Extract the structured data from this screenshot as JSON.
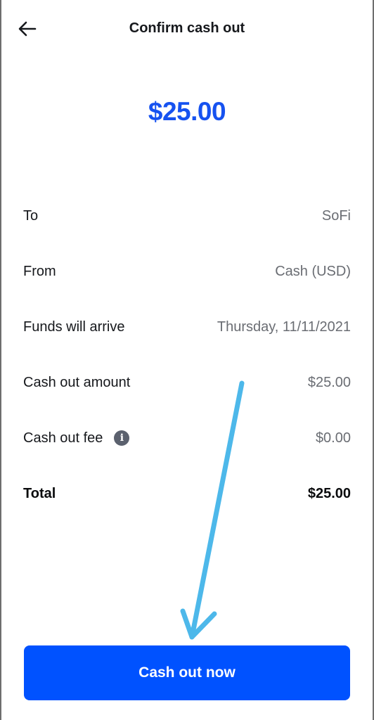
{
  "header": {
    "back_icon": "arrow-left-icon",
    "title": "Confirm cash out"
  },
  "amount": "$25.00",
  "details": [
    {
      "label": "To",
      "value": "SoFi"
    },
    {
      "label": "From",
      "value": "Cash (USD)"
    },
    {
      "label": "Funds will arrive",
      "value": "Thursday, 11/11/2021"
    },
    {
      "label": "Cash out amount",
      "value": "$25.00"
    },
    {
      "label": "Cash out fee",
      "value": "$0.00",
      "icon": "info-icon",
      "icon_glyph": "i"
    },
    {
      "label": "Total",
      "value": "$25.00"
    }
  ],
  "cta": {
    "label": "Cash out now"
  },
  "colors": {
    "accent": "#0052ff",
    "amount": "#1652f0",
    "annotation_arrow": "#4db8ea"
  }
}
